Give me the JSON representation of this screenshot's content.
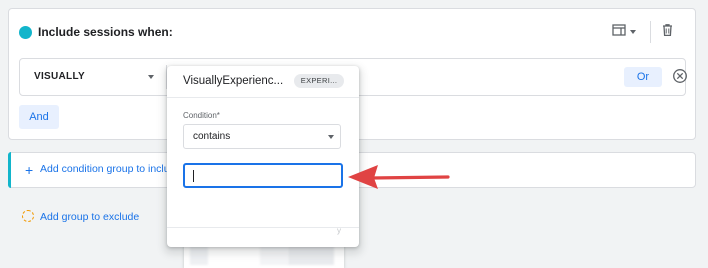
{
  "include_group": {
    "title": "Include sessions when:",
    "condition": {
      "dimension_label": "VISUALLY",
      "or_label": "Or"
    },
    "and_label": "And"
  },
  "add_condition_group": {
    "label": "Add condition group to includ"
  },
  "add_group_to_exclude": {
    "label": "Add group to exclude"
  },
  "popup": {
    "title": "VisuallyExperienc...",
    "chip": "EXPERI...",
    "condition_label": "Condition*",
    "condition_value": "contains",
    "value_input": ""
  },
  "colors": {
    "accent": "#12b5cb",
    "link_blue": "#1a73e8",
    "arrow_red": "#e04343",
    "exclude_dash": "#f29900"
  },
  "icons": {
    "header_layout": "table-view-icon",
    "header_delete": "trash-icon",
    "condition_remove": "remove-circle-icon",
    "add": "plus-icon",
    "exclude": "dashed-circle-icon",
    "annotation": "red-arrow-icon"
  }
}
